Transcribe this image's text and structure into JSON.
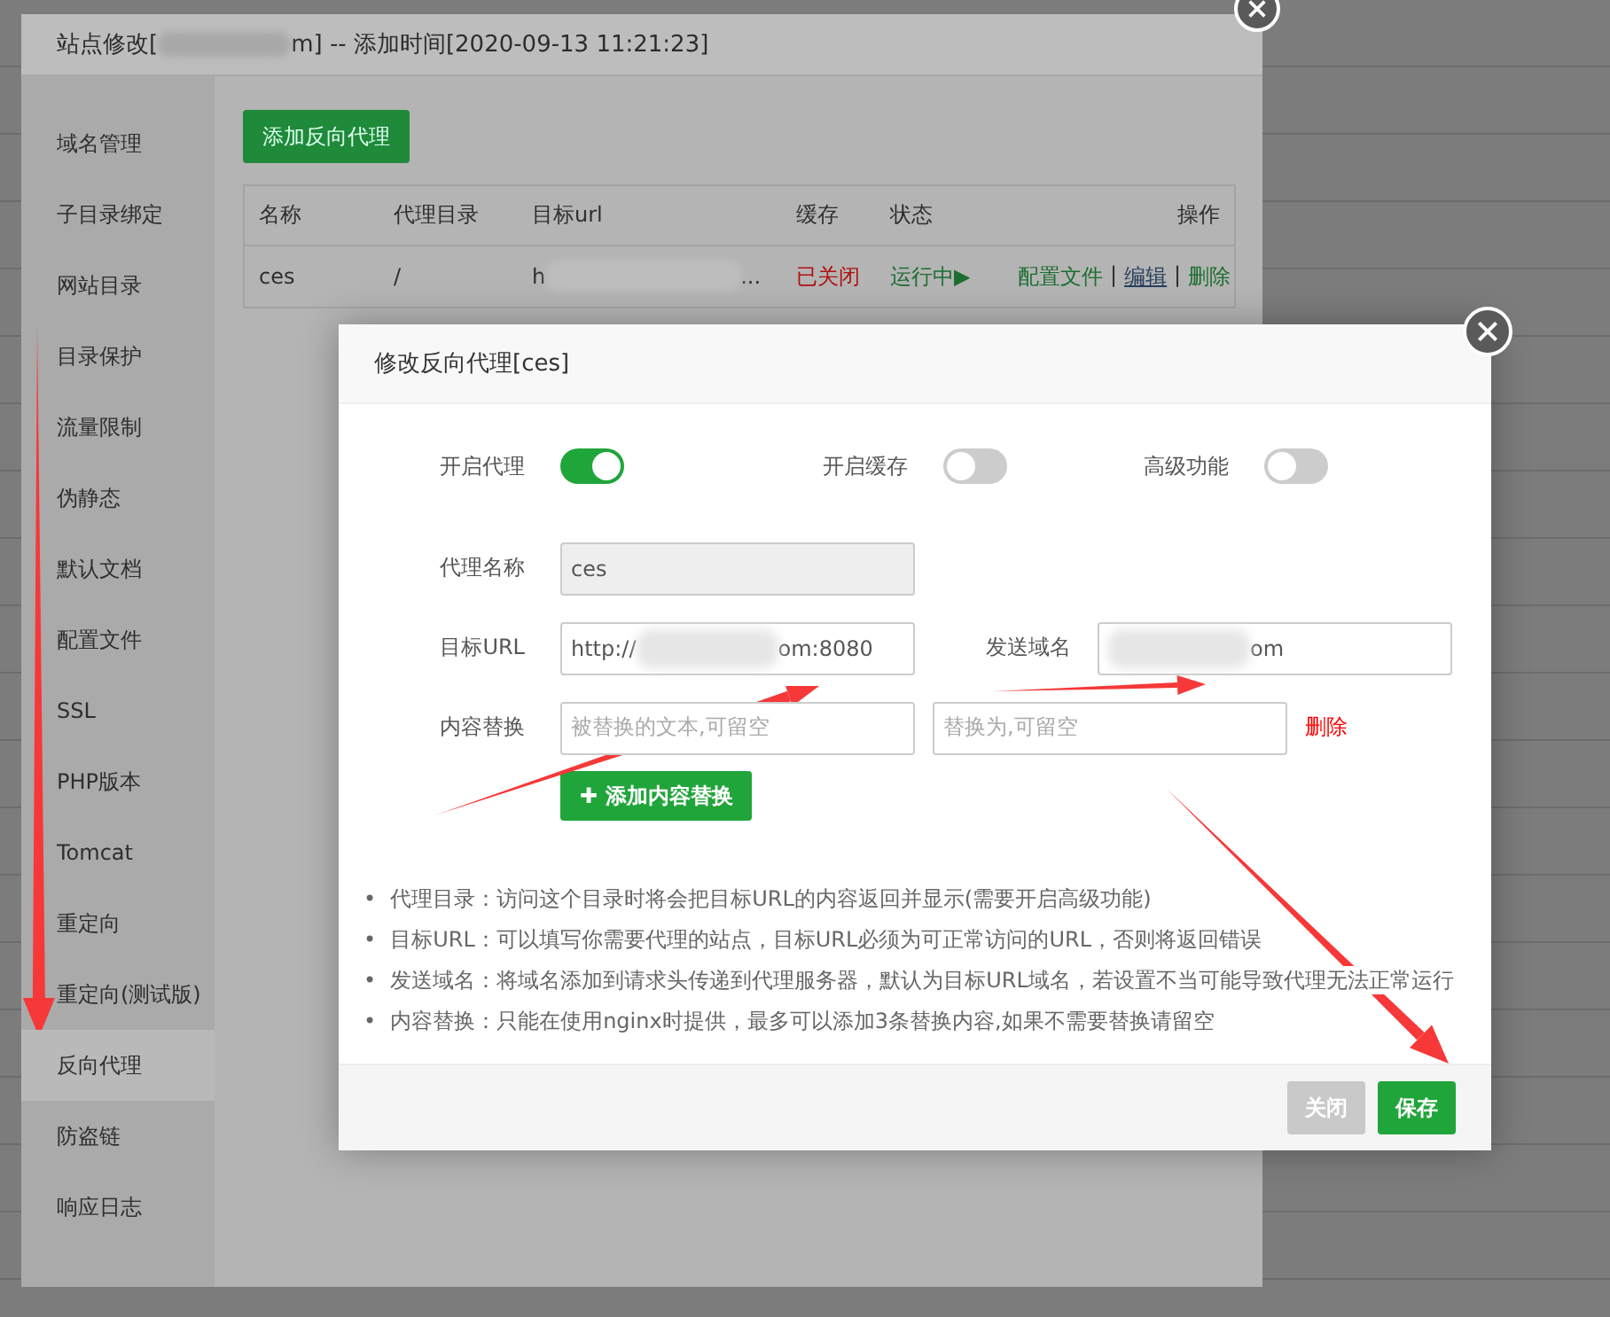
{
  "site_dialog": {
    "title_parts": [
      "站点修改[",
      "m] -- 添加时间[2020-09-13 11:21:23]"
    ],
    "sidebar": {
      "items": [
        {
          "label": "域名管理",
          "selected": false
        },
        {
          "label": "子目录绑定",
          "selected": false
        },
        {
          "label": "网站目录",
          "selected": false
        },
        {
          "label": "目录保护",
          "selected": false
        },
        {
          "label": "流量限制",
          "selected": false
        },
        {
          "label": "伪静态",
          "selected": false
        },
        {
          "label": "默认文档",
          "selected": false
        },
        {
          "label": "配置文件",
          "selected": false
        },
        {
          "label": "SSL",
          "selected": false
        },
        {
          "label": "PHP版本",
          "selected": false
        },
        {
          "label": "Tomcat",
          "selected": false
        },
        {
          "label": "重定向",
          "selected": false
        },
        {
          "label": "重定向(测试版)",
          "selected": false
        },
        {
          "label": "反向代理",
          "selected": true
        },
        {
          "label": "防盗链",
          "selected": false
        },
        {
          "label": "响应日志",
          "selected": false
        }
      ]
    },
    "add_button": "添加反向代理",
    "table": {
      "columns": [
        "名称",
        "代理目录",
        "目标url",
        "缓存",
        "状态",
        "操作"
      ],
      "rows": [
        {
          "name": "ces",
          "directory": "/",
          "target_url_parts": [
            "h",
            "..."
          ],
          "cache": {
            "text": "已关闭",
            "on": false
          },
          "status": {
            "text": "运行中▶",
            "running": true
          },
          "actions": [
            {
              "label": "配置文件",
              "kind": "plain"
            },
            {
              "label": "|",
              "kind": "separator"
            },
            {
              "label": "编辑",
              "kind": "underlined"
            },
            {
              "label": "|",
              "kind": "separator"
            },
            {
              "label": "删除",
              "kind": "plain"
            }
          ]
        }
      ]
    }
  },
  "proxy_dialog": {
    "title": "修改反向代理[ces]",
    "toggles": [
      {
        "label": "开启代理",
        "on": true
      },
      {
        "label": "开启缓存",
        "on": false
      },
      {
        "label": "高级功能",
        "on": false
      }
    ],
    "proxy_name": {
      "label": "代理名称",
      "value": "ces",
      "disabled": true
    },
    "target_url": {
      "label": "目标URL",
      "value_start": "http://",
      "value_end": "om:8080"
    },
    "send_domain": {
      "label": "发送域名",
      "value_end": "om"
    },
    "content_replace": {
      "label": "内容替换",
      "find_placeholder": "被替换的文本,可留空",
      "replace_placeholder": "替换为,可留空",
      "delete": "删除"
    },
    "add_replace_button": {
      "icon": "✚",
      "label": "添加内容替换"
    },
    "note_bullet": "•",
    "notes": [
      "代理目录：访问这个目录时将会把目标URL的内容返回并显示(需要开启高级功能)",
      "目标URL：可以填写你需要代理的站点，目标URL必须为可正常访问的URL，否则将返回错误",
      "发送域名：将域名添加到请求头传递到代理服务器，默认为目标URL域名，若设置不当可能导致代理无法正常运行",
      "内容替换：只能在使用nginx时提供，最多可以添加3条替换内容,如果不需要替换请留空"
    ],
    "buttons": [
      {
        "label": "关闭",
        "kind": "secondary"
      },
      {
        "label": "保存",
        "kind": "primary"
      }
    ]
  }
}
